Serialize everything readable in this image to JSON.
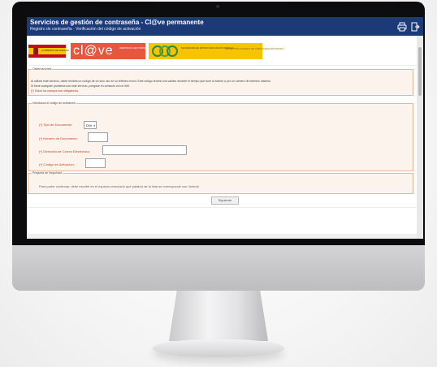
{
  "header": {
    "title": "Servicios de gestión de contraseña - Cl@ve permanente",
    "subtitle": "Registro de contraseña · Verificación del código de activación",
    "print_icon": "printer-icon",
    "exit_icon": "exit-icon"
  },
  "logos": {
    "ministry_text": "GOBIERNO DE ESPAÑA",
    "clave_word": "cl@ve",
    "clave_tag": "IDENTIDAD ELECTRÓNICA PARA LAS ADMINISTRACIONES",
    "sgad_text": "SECRETARÍA DE ESTADO DE FUNCIÓN PÚBLICA",
    "sgad_text2": "SECRETARÍA GENERAL DE ADMINISTRACIÓN DIGITAL"
  },
  "observaciones": {
    "legend": "Observaciones",
    "line1": "Al utilizar este servicio, usted recibirá un código de un solo uso en su teléfono móvil. Este código tendrá una validez durante el tiempo que dure la sesión o por un número de intentos máximo.",
    "line2": "Si tiene cualquier problema con este servicio, póngase en contacto con el 060.",
    "line3": "(*) Todos los campos son obligatorios."
  },
  "form": {
    "legend": "Introduzca el código de activación",
    "doc_type_label": "(*) Tipo de Documento:",
    "doc_type_value": "DNI",
    "doc_number_label": "(*) Número de Documento:",
    "email_label": "(*) Dirección de Correo Electrónico:",
    "code_label": "(*) Código de Activación:"
  },
  "security": {
    "legend": "Pregunta de Seguridad",
    "text": "Para poder continuar, debe escribir en el espacio reservado qué palabra de la lista se corresponde con: Animal"
  },
  "actions": {
    "submit_label": "Siguiente"
  }
}
